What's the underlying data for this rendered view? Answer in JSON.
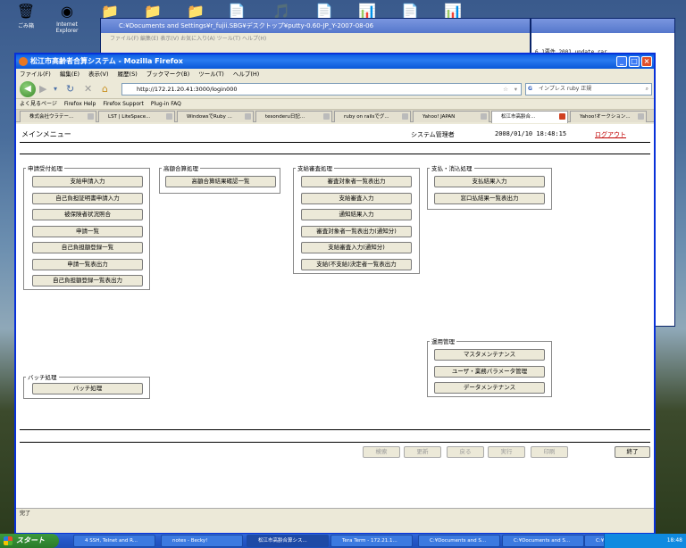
{
  "desktop": {
    "icons": [
      {
        "label": "ごみ箱",
        "glyph": "🗑",
        "name": "recycle-bin-icon"
      },
      {
        "label": "Internet Explorer",
        "glyph": "◉",
        "name": "ie-icon"
      },
      {
        "label": "",
        "glyph": "📁",
        "name": "folder-icon"
      },
      {
        "label": "",
        "glyph": "📁",
        "name": "folder-icon"
      },
      {
        "label": "",
        "glyph": "📁",
        "name": "folder-icon"
      },
      {
        "label": "",
        "glyph": "📄",
        "name": "document-icon"
      },
      {
        "label": "",
        "glyph": "🎵",
        "name": "media-icon"
      },
      {
        "label": "",
        "glyph": "📄",
        "name": "document-icon"
      },
      {
        "label": "",
        "glyph": "📊",
        "name": "excel-icon"
      },
      {
        "label": "",
        "glyph": "📄",
        "name": "document-icon"
      },
      {
        "label": "",
        "glyph": "📊",
        "name": "excel-icon"
      }
    ]
  },
  "bg_window": {
    "title": "C:¥Documents and Settings¥r_fujii.SBG¥デスクトップ¥putty-0.60-JP_Y-2007-08-06",
    "menu": "ファイル(F)   編集(E)   表示(V)   お気に入り(A)   ツール(T)   ヘルプ(H)",
    "right_text": "6_1要件_2001_update.rar"
  },
  "browser": {
    "title": "松江市高齢者合算システム - Mozilla Firefox",
    "menu": [
      "ファイル(F)",
      "編集(E)",
      "表示(V)",
      "履歴(S)",
      "ブックマーク(B)",
      "ツール(T)",
      "ヘルプ(H)"
    ],
    "url": "http://172.21.20.41:3000/login000",
    "search_placeholder": "インプレス ruby 正規",
    "bookmarks": [
      "よく見るページ",
      "Firefox Help",
      "Firefox Support",
      "Plug-in FAQ"
    ],
    "tabs": [
      {
        "label": "株式会社ウラテー...",
        "active": false
      },
      {
        "label": "LST | LiteSpace...",
        "active": false
      },
      {
        "label": "WindowsでRuby ...",
        "active": false
      },
      {
        "label": "tesonderu日記...",
        "active": false
      },
      {
        "label": "ruby on railsでグ...",
        "active": false
      },
      {
        "label": "Yahoo! JAPAN",
        "active": false
      },
      {
        "label": "松江市高齢合...",
        "active": true
      },
      {
        "label": "Yahoo!オークション...",
        "active": false
      }
    ],
    "status": "完了"
  },
  "page": {
    "title": "メインメニュー",
    "user": "システム管理者",
    "datetime": "2008/01/10 18:48:15",
    "logout": "ログアウト",
    "groups": {
      "shinsei": {
        "legend": "申請受付処理",
        "buttons": [
          "支給申請入力",
          "自己負担証明書申請入力",
          "被保険者状況照合",
          "申請一覧",
          "自己負担額登録一覧",
          "申請一覧表出力",
          "自己負担額登録一覧表出力"
        ]
      },
      "kougaku": {
        "legend": "高額合算処理",
        "buttons": [
          "高額合算結果確認一覧"
        ]
      },
      "shikyuu": {
        "legend": "支給審査処理",
        "buttons": [
          "審査対象者一覧表出力",
          "支給審査入力",
          "通知結果入力",
          "審査対象者一覧表出力(通知分)",
          "支給審査入力(通知分)",
          "支給(不支給)決定者一覧表出力"
        ]
      },
      "shiharai": {
        "legend": "支払・消込処理",
        "buttons": [
          "支払結果入力",
          "窓口払結果一覧表出力"
        ]
      },
      "unyou": {
        "legend": "運用管理",
        "buttons": [
          "マスタメンテナンス",
          "ユーザ・業務パラメータ管理",
          "データメンテナンス"
        ]
      },
      "batch": {
        "legend": "バッチ処理",
        "buttons": [
          "バッチ処理"
        ]
      }
    },
    "footer_buttons": [
      "検索",
      "更新",
      "戻る",
      "実行",
      "印刷"
    ],
    "end_button": "終了"
  },
  "taskbar": {
    "start": "スタート",
    "items": [
      {
        "label": "4 SSH, Telnet and R...",
        "active": false
      },
      {
        "label": "notes - Becky!",
        "active": false
      },
      {
        "label": "松江市高齢合算シス...",
        "active": true
      },
      {
        "label": "Tera Term - 172.21.1...",
        "active": false
      },
      {
        "label": "C:¥Documents and S...",
        "active": false
      },
      {
        "label": "C:¥Documents and S...",
        "active": false
      },
      {
        "label": "C:¥Documents and S...",
        "active": false
      }
    ],
    "clock": "18:48"
  }
}
